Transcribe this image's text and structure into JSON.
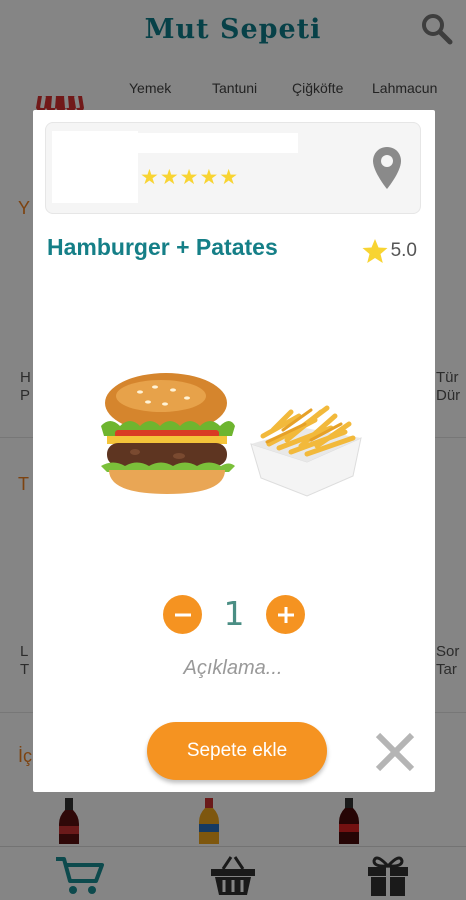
{
  "app": {
    "title": "Mut Sepeti",
    "tabs": [
      "Yemek",
      "Tantuni",
      "Çiğköfte",
      "Lahmacun"
    ],
    "background_fragments": [
      "Y",
      "H",
      "P",
      "Tür",
      "Dür",
      "T",
      "L",
      "T",
      "Sor",
      "Tar",
      "İç"
    ]
  },
  "modal": {
    "store_rating_stars": "★★★★★",
    "product_title": "Hamburger + Patates",
    "rating": "5.0",
    "quantity": "1",
    "note_placeholder": "Açıklama...",
    "add_to_cart_label": "Sepete ekle"
  },
  "icons": {
    "search": "search-icon",
    "store": "store-awning-icon",
    "location": "location-pin-icon",
    "star": "star-icon",
    "minus": "minus-icon",
    "plus": "plus-icon",
    "close": "close-icon",
    "cart": "cart-icon",
    "basket": "basket-icon",
    "gift": "gift-icon"
  },
  "colors": {
    "brand_teal": "#157f87",
    "accent_orange": "#f59321",
    "star_yellow": "#f8d432"
  }
}
